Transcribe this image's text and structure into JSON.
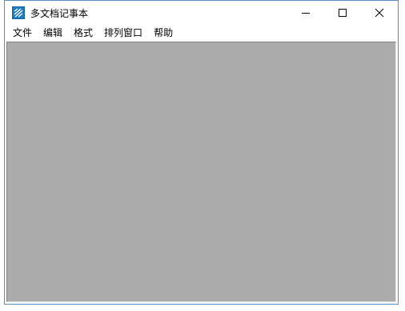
{
  "window": {
    "title": "多文档记事本",
    "app_icon": "notepad-lines-icon",
    "caption_buttons": [
      "minimize-icon",
      "maximize-icon",
      "close-icon"
    ]
  },
  "menubar": {
    "items": [
      "文件",
      "编辑",
      "格式",
      "排列窗口",
      "帮助"
    ]
  },
  "colors": {
    "window_border": "#5a8fc4",
    "client_background": "#ababab",
    "icon_blue": "#1e7bbf"
  }
}
